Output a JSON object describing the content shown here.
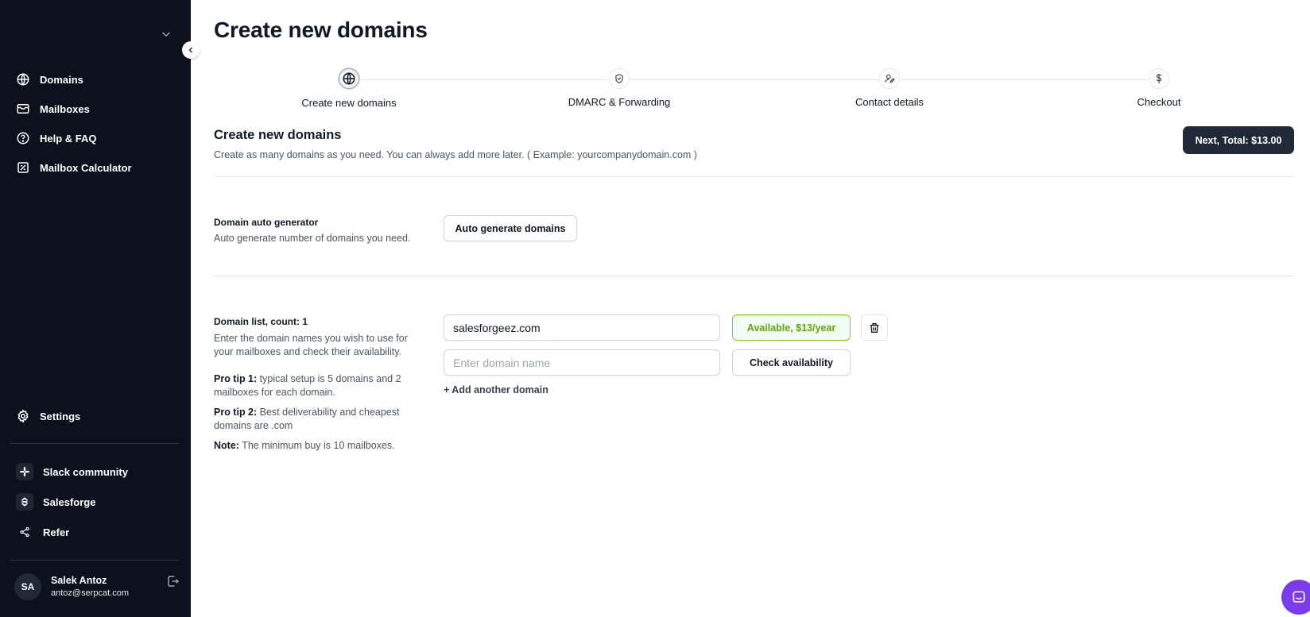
{
  "page": {
    "title": "Create new domains"
  },
  "sidebar": {
    "nav": [
      {
        "label": "Domains",
        "icon": "globe-icon"
      },
      {
        "label": "Mailboxes",
        "icon": "inbox-icon"
      },
      {
        "label": "Help & FAQ",
        "icon": "help-circle-icon"
      },
      {
        "label": "Mailbox Calculator",
        "icon": "calculator-icon"
      }
    ],
    "settings": {
      "label": "Settings",
      "icon": "gear-icon"
    },
    "external": [
      {
        "label": "Slack community",
        "icon": "slack-icon"
      },
      {
        "label": "Salesforge",
        "icon": "salesforge-icon"
      },
      {
        "label": "Refer",
        "icon": "share-icon"
      }
    ],
    "user": {
      "initials": "SA",
      "name": "Salek Antoz",
      "email": "antoz@serpcat.com"
    }
  },
  "stepper": {
    "steps": [
      {
        "label": "Create new domains",
        "icon": "globe-icon",
        "active": true
      },
      {
        "label": "DMARC & Forwarding",
        "icon": "shield-check-icon",
        "active": false
      },
      {
        "label": "Contact details",
        "icon": "user-edit-icon",
        "active": false
      },
      {
        "label": "Checkout",
        "icon": "dollar-icon",
        "active": false
      }
    ]
  },
  "section": {
    "title": "Create new domains",
    "description": "Create as many domains as you need. You can always add more later. ( Example: yourcompanydomain.com )",
    "next_button": "Next, Total: $13.00"
  },
  "auto_generator": {
    "title": "Domain auto generator",
    "description": "Auto generate number of domains you need.",
    "button": "Auto generate domains"
  },
  "domain_list": {
    "title": "Domain list, count: 1",
    "description": "Enter the domain names you wish to use for your mailboxes and check their availability.",
    "tip1_label": "Pro tip 1:",
    "tip1_text": " typical setup is 5 domains and 2 mailboxes for each domain.",
    "tip2_label": "Pro tip 2:",
    "tip2_text": " Best deliverability and cheapest domains are .com",
    "note_label": "Note:",
    "note_text": " The minimum buy is 10 mailboxes.",
    "domains": [
      {
        "value": "salesforgeez.com",
        "status": "Available, $13/year"
      }
    ],
    "new_domain_placeholder": "Enter domain name",
    "check_button": "Check availability",
    "add_link": "+ Add another domain"
  },
  "colors": {
    "sidebar_bg": "#0c111d",
    "primary_button": "#1f2937",
    "available_green": "#65a30d",
    "chat_purple": "#7c3aed"
  }
}
